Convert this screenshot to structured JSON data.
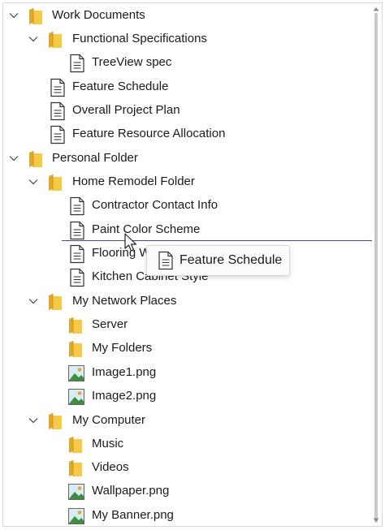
{
  "tree": {
    "nodes": [
      {
        "label": "Work Documents",
        "type": "folder",
        "expanded": true
      },
      {
        "label": "Functional Specifications",
        "type": "folder",
        "expanded": true
      },
      {
        "label": "TreeView spec",
        "type": "document"
      },
      {
        "label": "Feature Schedule",
        "type": "document"
      },
      {
        "label": "Overall Project Plan",
        "type": "document"
      },
      {
        "label": "Feature Resource Allocation",
        "type": "document"
      },
      {
        "label": "Personal Folder",
        "type": "folder",
        "expanded": true
      },
      {
        "label": "Home Remodel Folder",
        "type": "folder",
        "expanded": true
      },
      {
        "label": "Contractor Contact Info",
        "type": "document"
      },
      {
        "label": "Paint Color Scheme",
        "type": "document"
      },
      {
        "label": "Flooring W",
        "type": "document"
      },
      {
        "label": "Kitchen Cabinet Style",
        "type": "document"
      },
      {
        "label": "My Network Places",
        "type": "folder",
        "expanded": true
      },
      {
        "label": "Server",
        "type": "folder"
      },
      {
        "label": "My Folders",
        "type": "folder"
      },
      {
        "label": "Image1.png",
        "type": "image"
      },
      {
        "label": "Image2.png",
        "type": "image"
      },
      {
        "label": "My Computer",
        "type": "folder",
        "expanded": true
      },
      {
        "label": "Music",
        "type": "folder"
      },
      {
        "label": "Videos",
        "type": "folder"
      },
      {
        "label": "Wallpaper.png",
        "type": "image"
      },
      {
        "label": "My Banner.png",
        "type": "image"
      }
    ]
  },
  "drag_tooltip": {
    "label": "Feature Schedule",
    "icon": "document-icon"
  },
  "colors": {
    "drop_indicator": "#3b4ba0",
    "folder": "#f5c342",
    "text": "#1a1a1a"
  }
}
